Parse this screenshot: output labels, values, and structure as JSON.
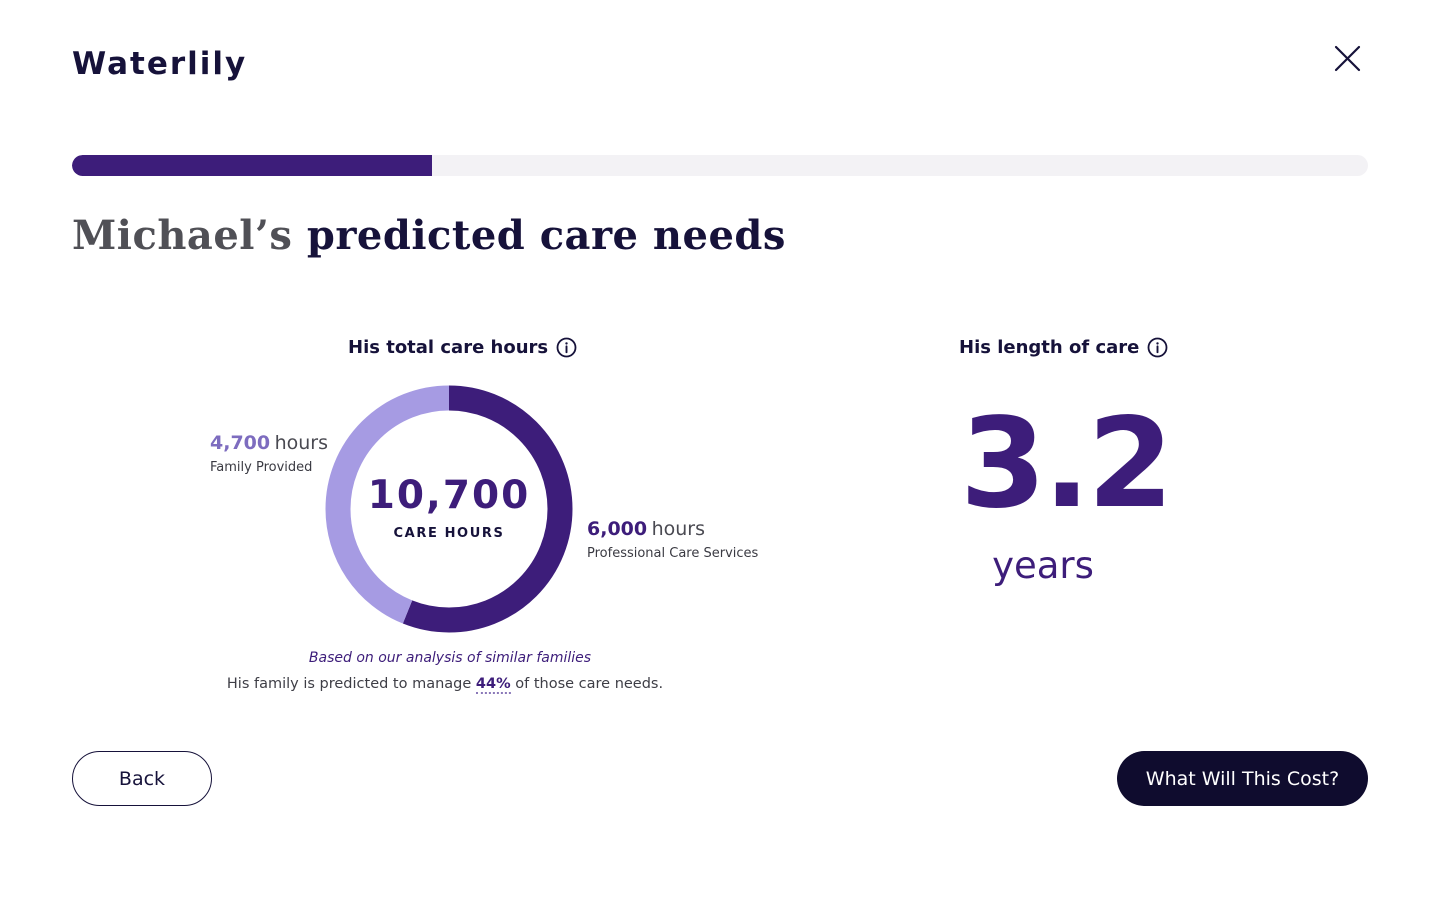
{
  "app": {
    "brand": "Waterlily"
  },
  "progress": {
    "fraction": 0.278
  },
  "title": {
    "name_part": "Michael’s",
    "rest": "predicted care needs"
  },
  "care_hours": {
    "heading": "His total care hours",
    "total_value": "10,700",
    "total_label": "CARE HOURS",
    "family": {
      "value": "4,700",
      "unit": "hours",
      "label": "Family Provided",
      "hours": 4700,
      "color": "#a69be3"
    },
    "professional": {
      "value": "6,000",
      "unit": "hours",
      "label": "Professional Care Services",
      "hours": 6000,
      "color": "#3d1d7a"
    },
    "footnote": "Based on our analysis of similar families",
    "summary_before": "His family is predicted to manage",
    "summary_percent": "44%",
    "summary_after": "of those care needs."
  },
  "length_of_care": {
    "heading": "His length of care",
    "value": "3.2",
    "unit": "years"
  },
  "buttons": {
    "back": "Back",
    "next": "What Will This Cost?"
  },
  "colors": {
    "accent": "#3d1d7a",
    "accent_light": "#a69be3",
    "dark": "#0f0c2e",
    "track": "#f3f2f5"
  },
  "icons": {
    "close": "close-icon",
    "info": "info-icon"
  }
}
